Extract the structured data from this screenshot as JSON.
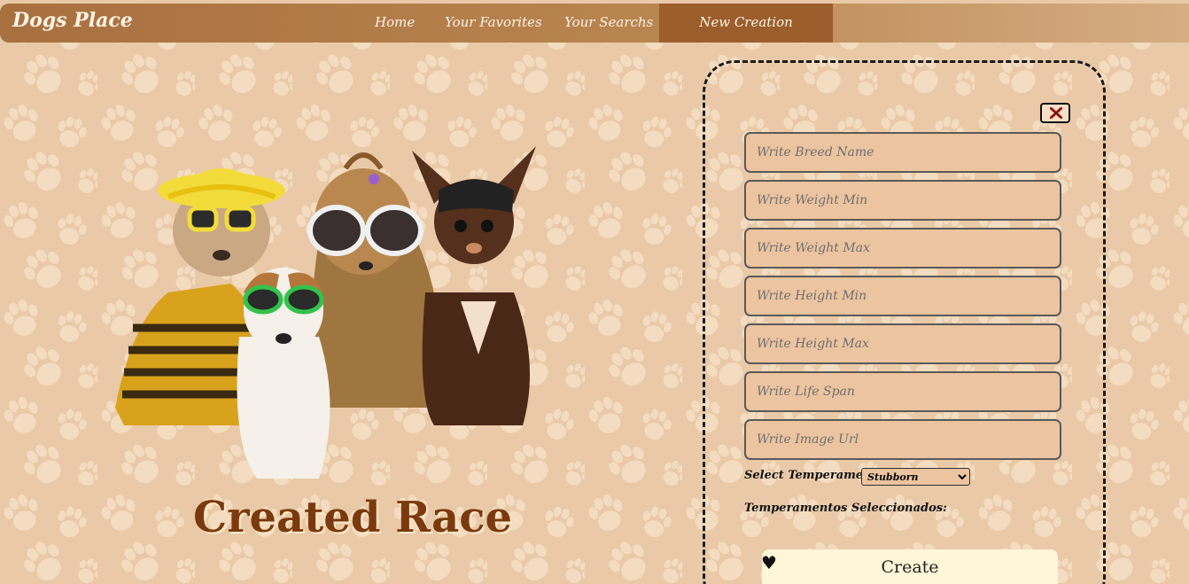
{
  "colors": {
    "background": "#e9c9a7",
    "paw_pattern": "#f4dcc0",
    "nav_start": "#a8703f",
    "nav_active": "#9b5e2c",
    "title": "#7a3a0e",
    "field_bg": "#ecc4a0",
    "create_bg": "#fff6d8"
  },
  "nav": {
    "brand": "Dogs Place",
    "links": [
      "Home",
      "Your Favorites",
      "Your Searchs",
      "New Creation"
    ],
    "active": "New Creation"
  },
  "hero": {
    "title": "Created Race",
    "image": "dogs-with-sunglasses"
  },
  "form": {
    "close_icon": "close-x-icon",
    "fields": [
      {
        "name": "breed-name-input",
        "placeholder": "Write Breed Name",
        "value": ""
      },
      {
        "name": "weight-min-input",
        "placeholder": "Write Weight Min",
        "value": ""
      },
      {
        "name": "weight-max-input",
        "placeholder": "Write Weight Max",
        "value": ""
      },
      {
        "name": "height-min-input",
        "placeholder": "Write Height Min",
        "value": ""
      },
      {
        "name": "height-max-input",
        "placeholder": "Write Height Max",
        "value": ""
      },
      {
        "name": "life-span-input",
        "placeholder": "Write Life Span",
        "value": ""
      },
      {
        "name": "image-url-input",
        "placeholder": "Write Image Url",
        "value": ""
      }
    ],
    "temperaments_label": "Select Temperaments",
    "temperament_selected": "Stubborn",
    "selected_label": "Temperamentos Seleccionados:",
    "heart_icon": "♥",
    "create_label": "Create"
  }
}
